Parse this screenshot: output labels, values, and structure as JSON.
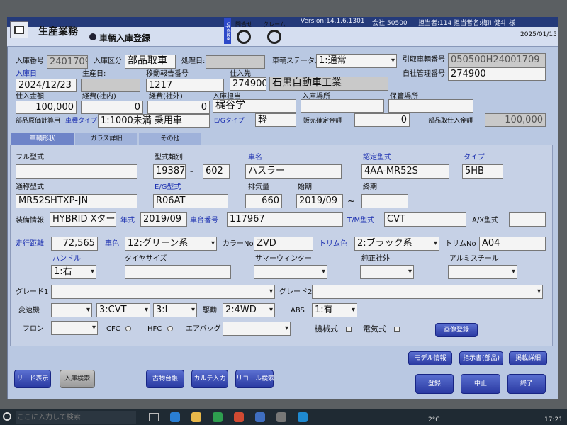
{
  "colors": {
    "window_bg": "#b9c8e2",
    "field_bg": "#f4f4f4",
    "button_blue": "#2a3aa2",
    "label_blue": "#1b2fb0"
  },
  "app": {
    "name": "生産業務",
    "screen_title": "車輌入庫登録",
    "update_badge": "Update",
    "top_icons": [
      {
        "label": "問合せ"
      },
      {
        "label": "クレーム"
      }
    ],
    "version": "Version:14.1.6.1301",
    "company": "会社:50500",
    "staff_no": "担当者:114",
    "staff_name": "担当者名:梅川健斗 様",
    "date": "2025/01/15"
  },
  "head": {
    "entry_no_label": "入庫番号",
    "entry_no": "2401709",
    "entry_class_label": "入庫区分",
    "entry_class": "部品取車",
    "process_date_label": "処理日:",
    "vehicle_status_label": "車輌ステータス",
    "vehicle_status": "1:通常",
    "pull_no_label": "引取車輌番号",
    "pull_no": "050500H24001709",
    "entry_date_label": "入庫日",
    "entry_date": "2024/12/23",
    "production_date_label": "生産日:",
    "transfer_no_label": "移動報告番号",
    "transfer_no": "1217",
    "supplier_label": "仕入先",
    "supplier_code": "274900",
    "supplier_name": "石黒自動車工業",
    "own_mgmt_no_label": "自社管理番号",
    "own_mgmt_no": "274900",
    "purchase_amount_label": "仕入金額",
    "purchase_amount": "100,000",
    "cost_in_label": "経費(社内)",
    "cost_in": "0",
    "cost_out_label": "経費(社外)",
    "cost_out": "0",
    "entry_staff_label": "入庫担当",
    "entry_staff": "梶谷学",
    "entry_place_label": "入庫場所",
    "storage_place_label": "保管場所",
    "parts_cost_label": "部品原価計算用",
    "vehicle_type_label": "車種タイプ",
    "vehicle_type": "1:1000未満 乗用車",
    "eg_type_label": "E/Gタイプ",
    "eg_type": "軽",
    "sales_amount_label": "販売確定金額",
    "sales_amount": "0",
    "parts_purchase_label": "部品取仕入金額",
    "parts_purchase": "100,000"
  },
  "tabs": [
    {
      "label": "車輌形状"
    },
    {
      "label": "ガラス詳細"
    },
    {
      "label": "その他"
    }
  ],
  "detail": {
    "full_model_label": "フル型式",
    "full_model": "",
    "model_class_label": "型式類別",
    "model_class_1": "19387",
    "model_dash": "–",
    "model_class_2": "602",
    "car_name_label": "車名",
    "car_name": "ハスラー",
    "cert_model_label": "認定型式",
    "cert_model": "4AA-MR52S",
    "type_label": "タイプ",
    "type": "5HB",
    "common_model_label": "通称型式",
    "common_model": "MR52SHTXP-JN",
    "eg_model_label": "E/G型式",
    "eg_model": "R06AT",
    "displacement_label": "排気量",
    "displacement": "660",
    "start_label": "始期",
    "start": "2019/09",
    "tilde": "~",
    "end_label": "終期",
    "end": "",
    "equip_label": "装備情報",
    "equip": "HYBRID Xター",
    "year_label": "年式",
    "year": "2019/09",
    "chassis_label": "車台番号",
    "chassis": "117967",
    "tm_label": "T/M型式",
    "tm": "CVT",
    "ax_label": "A/X型式",
    "ax": "",
    "mileage_label": "走行距離",
    "mileage": "72,565",
    "color_label": "車色",
    "color": "12:グリーン系",
    "color_no_label": "カラーNo",
    "color_no": "ZVD",
    "trim_color_label": "トリム色",
    "trim_color": "2:ブラック系",
    "trim_no_label": "トリムNo",
    "trim_no": "A04",
    "handle_label": "ハンドル",
    "handle": "1:右",
    "tire_label": "タイヤサイズ",
    "tire": "",
    "summer_winter_label": "サマーウィンター",
    "summer_winter": "",
    "genuine_label": "純正社外",
    "genuine": "",
    "alumi_label": "アルミスチール",
    "alumi": "",
    "grade1_label": "グレード1",
    "grade1": "",
    "grade2_label": "グレード2",
    "grade2": "",
    "transmission_label": "変速機",
    "trans_1": "",
    "trans_2": "3:CVT",
    "trans_3": "3:I",
    "drive_label": "駆動",
    "drive": "2:4WD",
    "abs_label": "ABS",
    "abs": "1:有",
    "freon_label": "フロン",
    "freon": "",
    "cfc_label": "CFC",
    "hfc_label": "HFC",
    "airbag_label": "エアバッグ",
    "airbag": "",
    "mechanical_label": "機械式",
    "electric_label": "電気式",
    "image_reg_label": "画像登録"
  },
  "side_buttons": [
    {
      "label": "モデル情報"
    },
    {
      "label": "指示書(部品)"
    },
    {
      "label": "掲載詳細"
    }
  ],
  "bottom_buttons": {
    "read_display": "リード表示",
    "entry_search": "入庫検索",
    "old_ledger": "古物台帳",
    "karte_input": "カルテ入力",
    "recall_search": "リコール検索",
    "register": "登録",
    "cancel": "中止",
    "exit": "終了"
  },
  "taskbar": {
    "search_placeholder": "ここに入力して検索",
    "temperature": "2°C",
    "time": "17:21"
  }
}
